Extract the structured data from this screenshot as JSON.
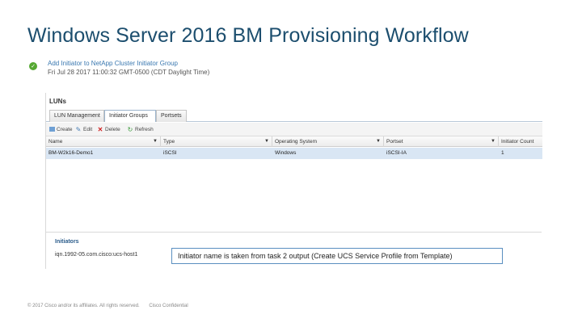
{
  "slide": {
    "title": "Windows Server 2016 BM Provisioning Workflow"
  },
  "task": {
    "title": "Add Initiator to NetApp Cluster Initiator Group",
    "date": "Fri Jul 28 2017 11:00:32 GMT-0500 (CDT Daylight Time)"
  },
  "panel": {
    "header": "LUNs",
    "tabs": [
      {
        "label": "LUN Management"
      },
      {
        "label": "Initiator Groups"
      },
      {
        "label": "Portsets"
      }
    ],
    "toolbar": {
      "create": "Create",
      "edit": "Edit",
      "delete": "Delete",
      "refresh": "Refresh"
    },
    "columns": [
      "Name",
      "Type",
      "Operating System",
      "Portset",
      "Initiator Count"
    ],
    "rows": [
      [
        "BM-W2k16-Demo1",
        "iSCSI",
        "Windows",
        "iSCSI-IA",
        "1"
      ]
    ]
  },
  "initiators": {
    "title": "Initiators",
    "items": [
      "iqn.1992-05.com.cisco:ucs-host1"
    ]
  },
  "callout": "Initiator name is taken from task 2 output (Create UCS Service Profile from Template)",
  "footer": {
    "copyright": "© 2017 Cisco and/or its affiliates. All rights reserved.",
    "confidential": "Cisco Confidential"
  },
  "colors": {
    "title": "#1c4e6e",
    "link": "#3a78b0",
    "success": "#55a832",
    "selected_row": "#d9e6f4",
    "callout_border": "#5a8fc0"
  }
}
